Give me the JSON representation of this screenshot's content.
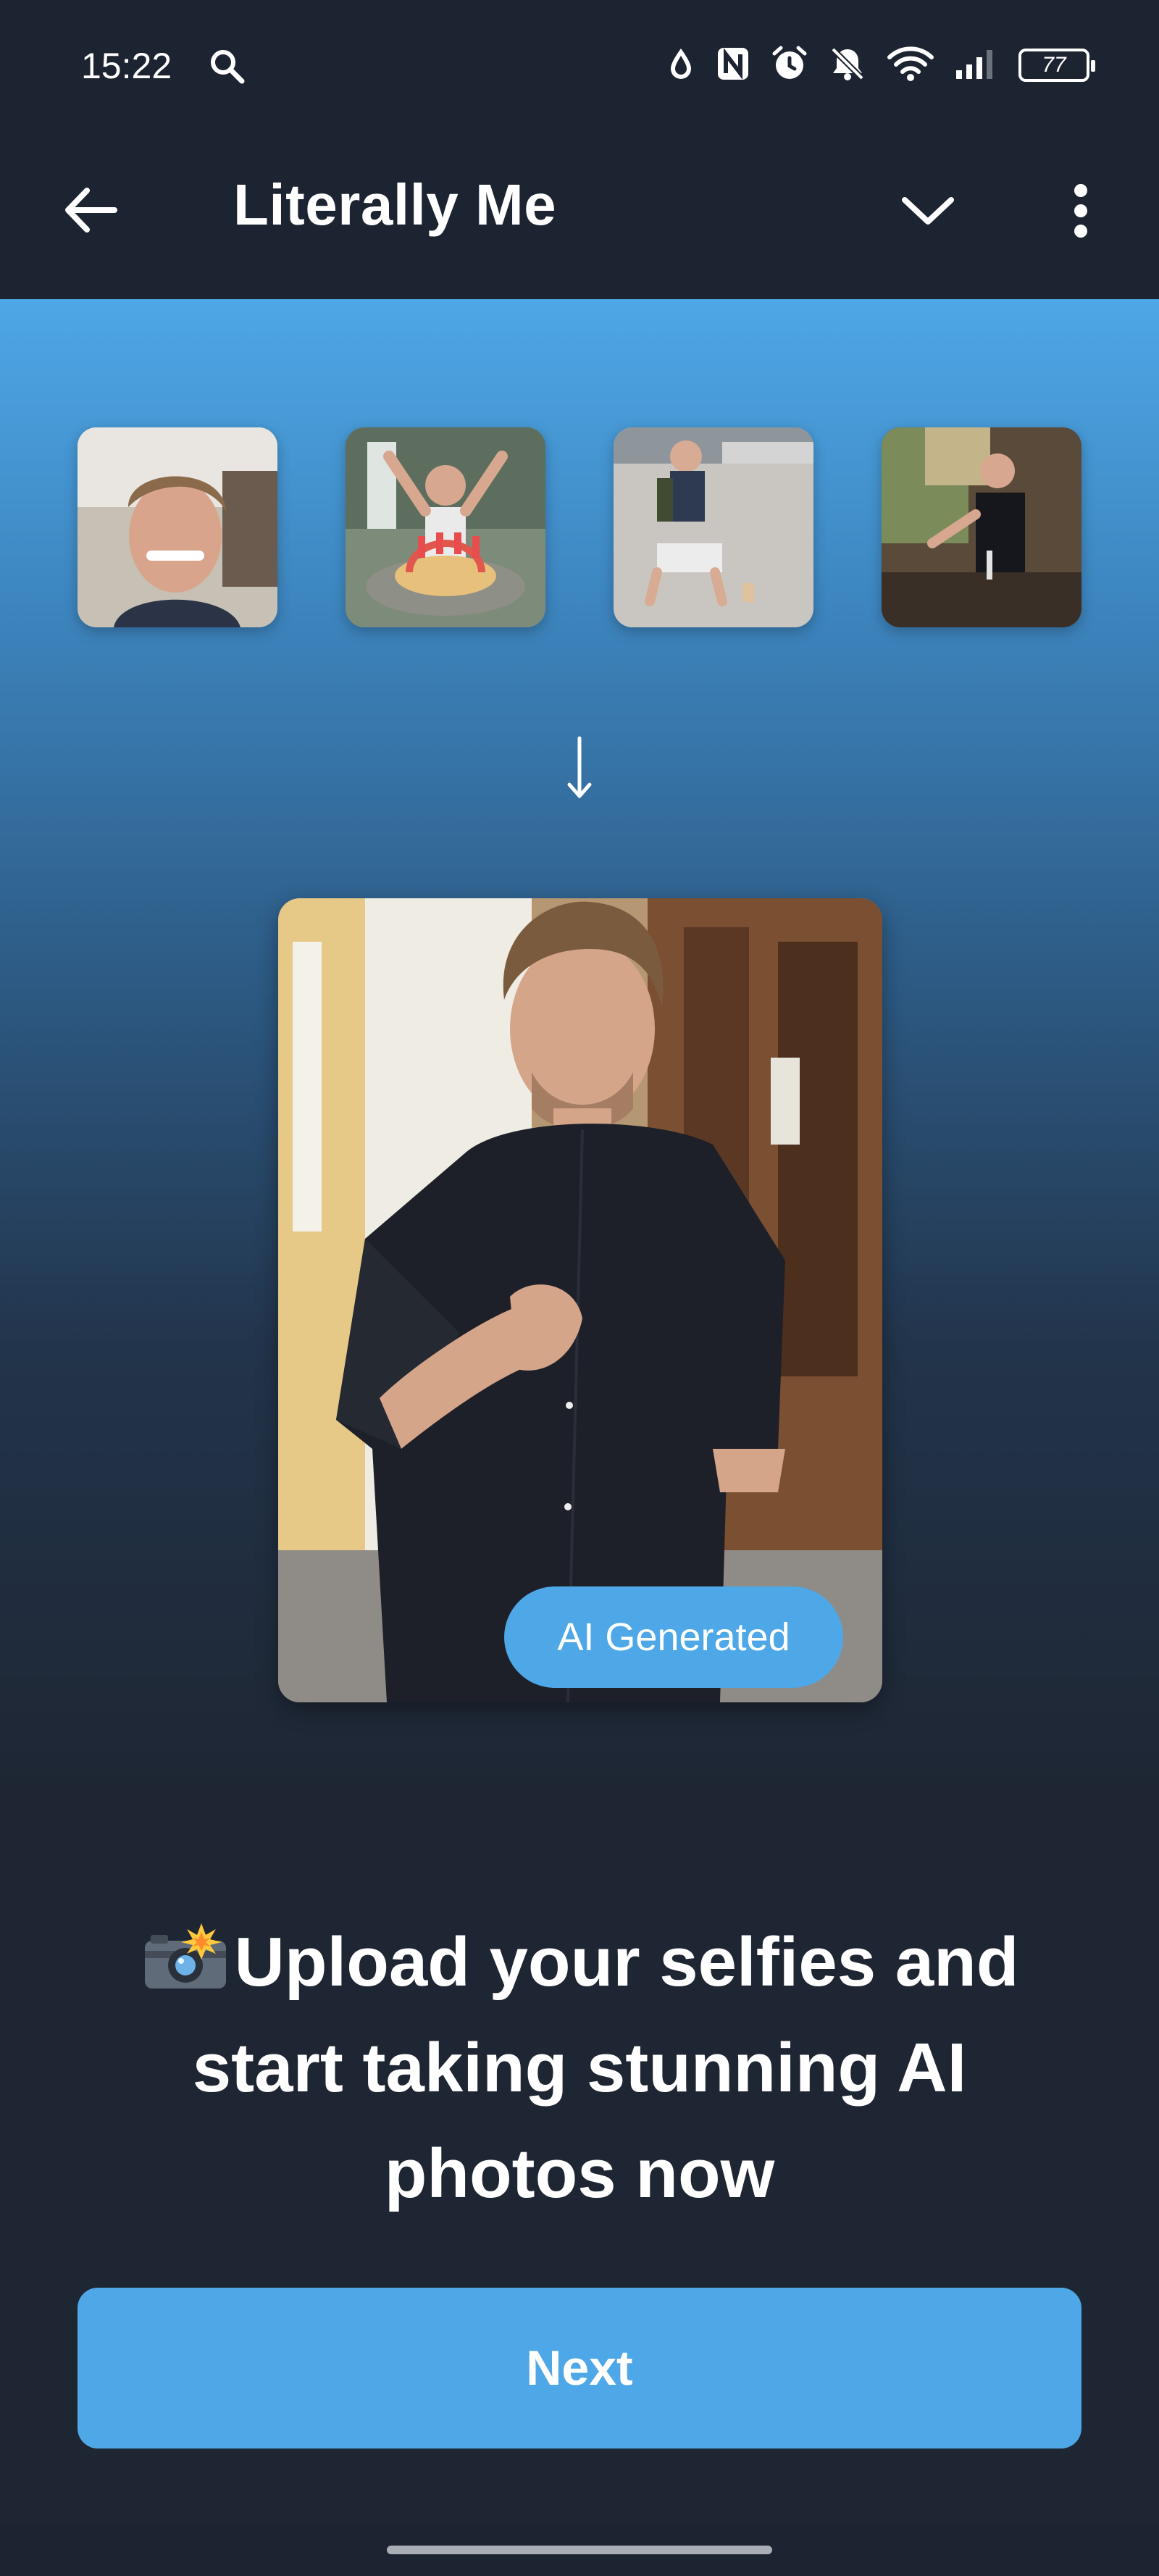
{
  "status_bar": {
    "time": "15:22",
    "battery": "77",
    "icons": [
      "search-icon",
      "water-drop-icon",
      "nfc-icon",
      "alarm-icon",
      "bell-off-icon",
      "wifi-icon",
      "signal-icon",
      "battery-icon"
    ]
  },
  "app_bar": {
    "title": "Literally Me",
    "back_icon": "arrow-left-icon",
    "dropdown_icon": "chevron-down-icon",
    "menu_icon": "more-vertical-icon"
  },
  "hero": {
    "thumbnails": [
      "selfie-thumbnail-1",
      "selfie-thumbnail-2",
      "selfie-thumbnail-3",
      "selfie-thumbnail-4"
    ],
    "arrow": "↓",
    "badge": "AI Generated"
  },
  "headline": {
    "emoji": "camera-flash-emoji",
    "text": "Upload your selfies and start taking stunning AI photos now"
  },
  "next_button": "Next",
  "colors": {
    "accent": "#4ea7e6",
    "background": "#1e2633",
    "bar": "#1c2431"
  }
}
